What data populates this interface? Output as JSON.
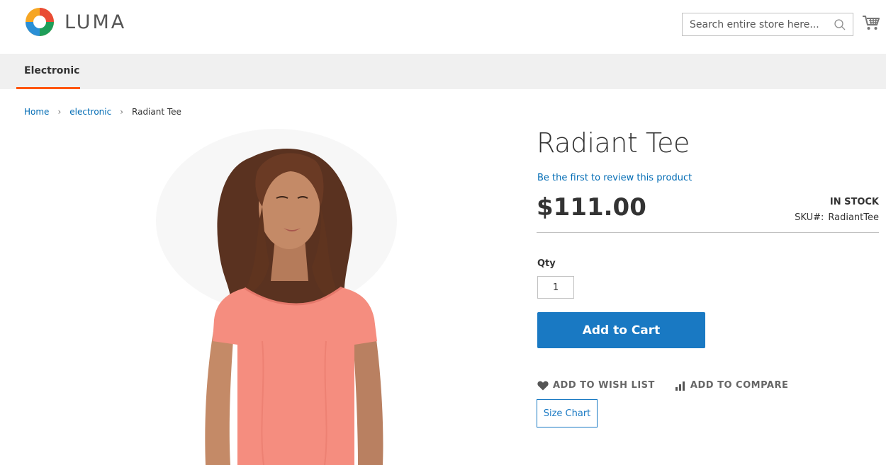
{
  "header": {
    "brand": "LUMA",
    "search": {
      "placeholder": "Search entire store here..."
    }
  },
  "nav": {
    "items": [
      {
        "label": "Electronic"
      }
    ]
  },
  "breadcrumb": {
    "items": [
      "Home",
      "electronic",
      "Radiant Tee"
    ]
  },
  "product": {
    "name": "Radiant Tee",
    "review_link": "Be the first to review this product",
    "price": "$111.00",
    "stock": "IN STOCK",
    "sku_label": "SKU#:",
    "sku_value": "RadiantTee",
    "qty_label": "Qty",
    "qty_value": "1",
    "add_to_cart": "Add to Cart",
    "wishlist": "ADD TO WISH LIST",
    "compare": "ADD TO COMPARE",
    "size_chart": "Size Chart"
  },
  "colors": {
    "accent": "#1979c3",
    "nav_underline": "#ff5501",
    "link": "#006bb4",
    "tee": "#f58d7f"
  }
}
